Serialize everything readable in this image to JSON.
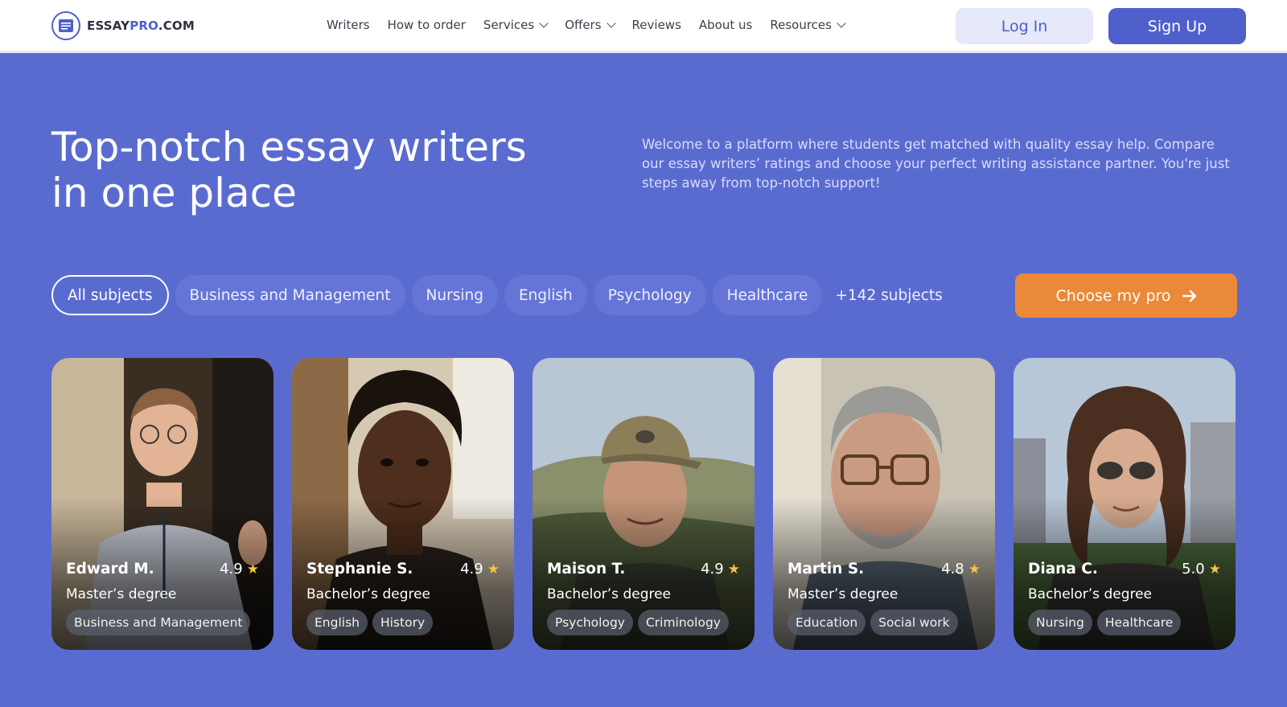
{
  "header": {
    "logo": {
      "prefix": "ESSAY",
      "accent": "PRO",
      "suffix": ".COM"
    },
    "nav": [
      {
        "label": "Writers",
        "dropdown": false
      },
      {
        "label": "How to order",
        "dropdown": false
      },
      {
        "label": "Services",
        "dropdown": true
      },
      {
        "label": "Offers",
        "dropdown": true
      },
      {
        "label": "Reviews",
        "dropdown": false
      },
      {
        "label": "About us",
        "dropdown": false
      },
      {
        "label": "Resources",
        "dropdown": true
      }
    ],
    "login_label": "Log In",
    "signup_label": "Sign Up"
  },
  "hero": {
    "title_line1": "Top-notch essay writers",
    "title_line2": "in one place",
    "description": "Welcome to a platform where students get matched with quality essay help. Compare our essay writers’ ratings and choose your perfect writing assistance partner. You're just steps away from top-notch support!"
  },
  "subjects": {
    "chips": [
      "All subjects",
      "Business and Management",
      "Nursing",
      "English",
      "Psychology",
      "Healthcare"
    ],
    "active": 0,
    "more_label": "+142 subjects",
    "cta_label": "Choose my pro"
  },
  "writers": [
    {
      "name": "Edward M.",
      "rating": "4.9",
      "degree": "Master’s degree",
      "tags": [
        "Business and Management"
      ]
    },
    {
      "name": "Stephanie S.",
      "rating": "4.9",
      "degree": "Bachelor’s degree",
      "tags": [
        "English",
        "History"
      ]
    },
    {
      "name": "Maison T.",
      "rating": "4.9",
      "degree": "Bachelor’s degree",
      "tags": [
        "Psychology",
        "Criminology"
      ]
    },
    {
      "name": "Martin S.",
      "rating": "4.8",
      "degree": "Master’s degree",
      "tags": [
        "Education",
        "Social work"
      ]
    },
    {
      "name": "Diana C.",
      "rating": "5.0",
      "degree": "Bachelor’s degree",
      "tags": [
        "Nursing",
        "Healthcare"
      ]
    }
  ],
  "colors": {
    "brand": "#4f5fcb",
    "hero_bg": "#5a6bd0",
    "cta": "#ea8937",
    "star": "#f6c244"
  }
}
